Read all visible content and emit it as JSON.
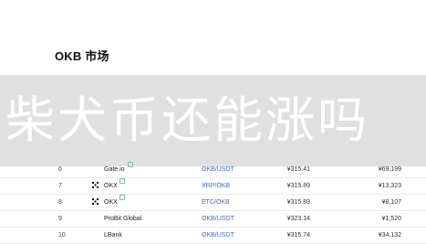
{
  "page": {
    "title": "OKB 市场"
  },
  "banner": {
    "text": "柴犬币还能涨吗"
  },
  "markets": [
    {
      "rank": "6",
      "exchange": "Gate.io",
      "logo": "",
      "verified_icon": "check-icon",
      "pair": "OKB/USDT",
      "price": "¥315.41",
      "volume": "¥69,199"
    },
    {
      "rank": "7",
      "exchange": "OKX",
      "logo": "okx-logo",
      "verified_icon": "check-icon",
      "pair": "XRP/OKB",
      "price": "¥315.89",
      "volume": "¥13,323"
    },
    {
      "rank": "8",
      "exchange": "OKX",
      "logo": "okx-logo",
      "verified_icon": "check-icon",
      "pair": "ETC/OKB",
      "price": "¥315.89",
      "volume": "¥8,107"
    },
    {
      "rank": "9",
      "exchange": "ProBit Global",
      "logo": "",
      "verified_icon": "",
      "pair": "OKB/USDT",
      "price": "¥323.14",
      "volume": "¥1,520"
    },
    {
      "rank": "10",
      "exchange": "LBank",
      "logo": "",
      "verified_icon": "",
      "pair": "OKB/USDT",
      "price": "¥315.74",
      "volume": "¥34,132"
    }
  ]
}
